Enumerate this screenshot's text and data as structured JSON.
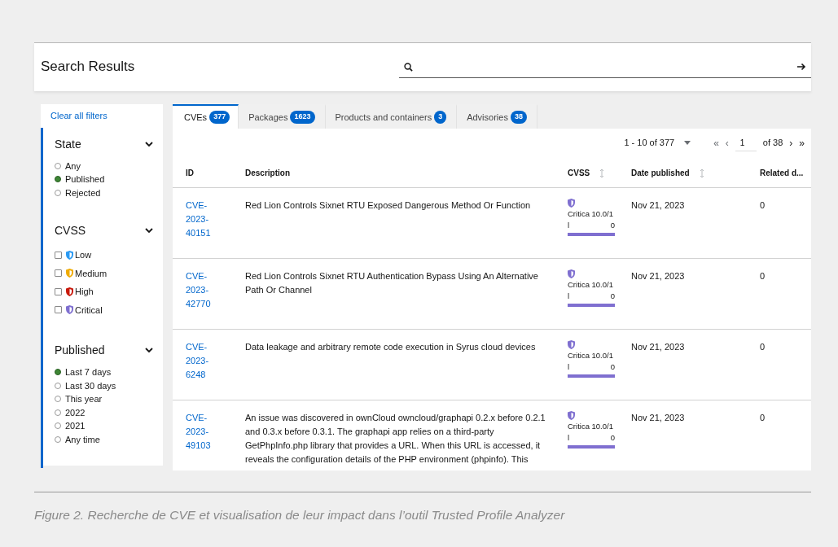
{
  "header": {
    "title": "Search Results"
  },
  "filters": {
    "clear_link": "Clear all filters",
    "groups": [
      {
        "title": "State",
        "kind": "radio",
        "expanded": true,
        "options": [
          {
            "label": "Any",
            "selected": false
          },
          {
            "label": "Published",
            "selected": true
          },
          {
            "label": "Rejected",
            "selected": false
          }
        ]
      },
      {
        "title": "CVSS",
        "kind": "checkbox",
        "expanded": true,
        "options": [
          {
            "label": "Low",
            "checked": false,
            "color": "#2b9af3"
          },
          {
            "label": "Medium",
            "checked": false,
            "color": "#f0ab00"
          },
          {
            "label": "High",
            "checked": false,
            "color": "#c9190b"
          },
          {
            "label": "Critical",
            "checked": false,
            "color": "#7f6fd0"
          }
        ]
      },
      {
        "title": "Published",
        "kind": "radio",
        "expanded": true,
        "options": [
          {
            "label": "Last 7 days",
            "selected": true
          },
          {
            "label": "Last 30 days",
            "selected": false
          },
          {
            "label": "This year",
            "selected": false
          },
          {
            "label": "2022",
            "selected": false
          },
          {
            "label": "2021",
            "selected": false
          },
          {
            "label": "Any time",
            "selected": false
          }
        ]
      }
    ]
  },
  "tabs": [
    {
      "label": "CVEs",
      "count": "377",
      "selected": true
    },
    {
      "label": "Packages",
      "count": "1623",
      "selected": false
    },
    {
      "label": "Products and containers",
      "count": "3",
      "selected": false
    },
    {
      "label": "Advisories",
      "count": "38",
      "selected": false
    }
  ],
  "pagination": {
    "range": "1 - 10 of 377",
    "first": "«",
    "previous": "‹",
    "page": "1",
    "of": "of 38",
    "next": "›",
    "last": "»"
  },
  "table": {
    "columns": [
      {
        "label": "ID",
        "sortable": false
      },
      {
        "label": "Description",
        "sortable": false
      },
      {
        "label": "CVSS",
        "sortable": true
      },
      {
        "label": "Date published",
        "sortable": true
      },
      {
        "label": "Related d...",
        "sortable": false
      }
    ],
    "rows": [
      {
        "id": [
          "CVE-",
          "2023-",
          "40151"
        ],
        "description": "Red Lion Controls Sixnet RTU Exposed Dangerous Method Or Function",
        "cvss": {
          "parts": [
            "Critica 10.0/1",
            "l",
            "0"
          ],
          "level": 1,
          "color": "#7f6fd0"
        },
        "date": "Nov 21, 2023",
        "related": "0"
      },
      {
        "id": [
          "CVE-",
          "2023-",
          "42770"
        ],
        "description": "Red Lion Controls Sixnet RTU Authentication Bypass Using An Alternative Path Or Channel",
        "cvss": {
          "parts": [
            "Critica 10.0/1",
            "l",
            "0"
          ],
          "level": 1,
          "color": "#7f6fd0"
        },
        "date": "Nov 21, 2023",
        "related": "0"
      },
      {
        "id": [
          "CVE-",
          "2023-",
          "6248"
        ],
        "description": "Data leakage and arbitrary remote code execution in Syrus cloud devices",
        "cvss": {
          "parts": [
            "Critica 10.0/1",
            "l",
            "0"
          ],
          "level": 1,
          "color": "#7f6fd0"
        },
        "date": "Nov 21, 2023",
        "related": "0"
      },
      {
        "id": [
          "CVE-",
          "2023-",
          "49103"
        ],
        "description": "An issue was discovered in ownCloud owncloud/graphapi 0.2.x before 0.2.1 and 0.3.x before 0.3.1. The graphapi app relies on a third-party GetPhpInfo.php library that provides a URL. When this URL is accessed, it reveals the configuration details of the PHP environment (phpinfo). This",
        "cvss": {
          "parts": [
            "Critica 10.0/1",
            "l",
            "0"
          ],
          "level": 1,
          "color": "#7f6fd0"
        },
        "date": "Nov 21, 2023",
        "related": "0"
      }
    ]
  },
  "caption": "Figure 2. Recherche de CVE et visualisation de leur impact dans l’outil Trusted Profile Analyzer"
}
